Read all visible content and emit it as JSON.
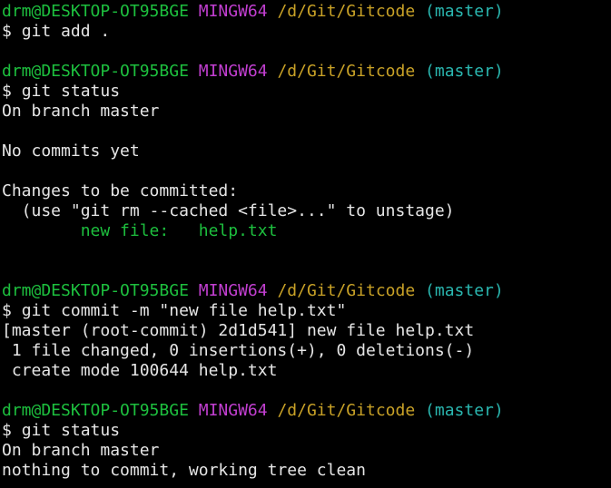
{
  "colors": {
    "background": "#000000",
    "text": "#e6e6e6",
    "user_host": "#1dbf3e",
    "env": "#c23fd1",
    "path": "#c9a227",
    "branch": "#2ab7b0",
    "staged_file": "#1dbf3e"
  },
  "prompt": {
    "user_host": "drm@DESKTOP-OT95BGE",
    "env": "MINGW64",
    "path": "/d/Git/Gitcode",
    "branch": "(master)",
    "symbol": "$"
  },
  "commands": {
    "cmd1": "git add .",
    "cmd2": "git status",
    "cmd3": "git commit -m \"new file help.txt\"",
    "cmd4": "git status"
  },
  "output": {
    "status1": {
      "on_branch": "On branch master",
      "no_commits": "No commits yet",
      "changes_header": "Changes to be committed:",
      "hint": "  (use \"git rm --cached <file>...\" to unstage)",
      "new_file": "        new file:   help.txt"
    },
    "commit": {
      "summary": "[master (root-commit) 2d1d541] new file help.txt",
      "changed": " 1 file changed, 0 insertions(+), 0 deletions(-)",
      "create_mode": " create mode 100644 help.txt"
    },
    "status2": {
      "on_branch": "On branch master",
      "clean": "nothing to commit, working tree clean"
    }
  }
}
